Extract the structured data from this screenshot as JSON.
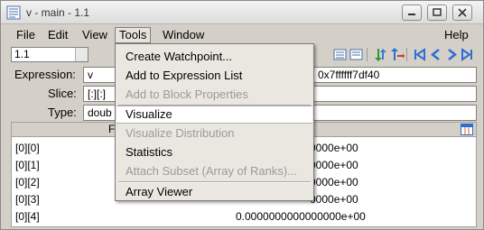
{
  "window": {
    "title": "v - main - 1.1"
  },
  "menubar": {
    "file": "File",
    "edit": "Edit",
    "view": "View",
    "tools": "Tools",
    "window": "Window",
    "help": "Help"
  },
  "toolbar": {
    "frame_value": "1.1"
  },
  "form": {
    "expression_label": "Expression:",
    "expression_value": "v",
    "address_value": "0x7ffffff7df40",
    "slice_label": "Slice:",
    "slice_value": "[:][:]",
    "type_label": "Type:",
    "type_value": "doub"
  },
  "table": {
    "header_field": "F",
    "rows": [
      {
        "index": "[0][0]",
        "value": "0000e+00"
      },
      {
        "index": "[0][1]",
        "value": "0000e+00"
      },
      {
        "index": "[0][2]",
        "value": "0000e+00"
      },
      {
        "index": "[0][3]",
        "value": "0000e+00"
      },
      {
        "index": "[0][4]",
        "value": "0.0000000000000000e+00"
      }
    ]
  },
  "tools_menu": {
    "create_watchpoint": "Create Watchpoint...",
    "add_to_expression_list": "Add to Expression List",
    "add_to_block_properties": "Add to Block Properties",
    "visualize": "Visualize",
    "visualize_distribution": "Visualize Distribution",
    "statistics": "Statistics",
    "attach_subset": "Attach Subset (Array of Ranks)...",
    "array_viewer": "Array Viewer"
  },
  "colors": {
    "window_bg": "#d4d0c8",
    "menu_bg": "#eae7e1",
    "disabled_text": "#9a9a9a",
    "toolbar_blue": "#2b6fd6",
    "toolbar_green": "#2f9a2f"
  }
}
